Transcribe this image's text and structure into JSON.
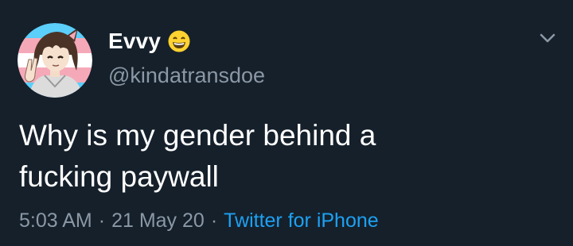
{
  "tweet": {
    "user": {
      "display_name": "Evvy",
      "handle": "@kindatransdoe",
      "name_emoji": "grinning-face-with-smiling-eyes",
      "avatar": "anime-character-avatar-with-trans-flag-background"
    },
    "text": "Why is my gender behind a\nfucking paywall",
    "time": "5:03 AM",
    "separator": "·",
    "date": "21 May 20",
    "source": "Twitter for iPhone",
    "menu_icon": "chevron-down-icon"
  },
  "colors": {
    "background": "#15202b",
    "primary_text": "#ffffff",
    "secondary_text": "#8b98a5",
    "link": "#1da1f2",
    "trans_blue": "#5bcefa",
    "trans_pink": "#f5a9b8",
    "emoji_yellow": "#ffd230"
  }
}
